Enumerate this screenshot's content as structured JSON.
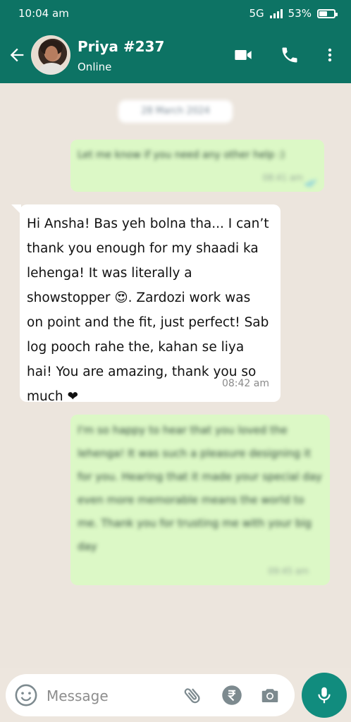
{
  "status_bar": {
    "time": "10:04 am",
    "network": "5G",
    "battery": "53%",
    "battery_level": 0.53
  },
  "header": {
    "name": "Priya #237",
    "status": "Online",
    "icons": [
      "back-arrow-icon",
      "video-call-icon",
      "voice-call-icon",
      "more-options-icon"
    ]
  },
  "chat": {
    "date_label": "28 March 2024",
    "messages": [
      {
        "direction": "outgoing",
        "text": "Let me know if you need any other help :)",
        "time": "08:41 am",
        "blurred": true
      },
      {
        "direction": "incoming",
        "text": "Hi Ansha! Bas yeh bolna tha... I can’t thank you enough for my shaadi ka lehenga! It was literally a showstopper 😍. Zardozi work was on point and the fit, just perfect! Sab log pooch rahe the, kahan se liya hai! You are amazing, thank you so much ❤",
        "time": "08:42 am"
      },
      {
        "direction": "outgoing",
        "text": "I'm so happy to hear that you loved the lehenga! It was such a pleasure designing it for you. Hearing that it made your special day even more memorable means the world to me. Thank you for trusting me with your big day",
        "time": "09:45 am",
        "blurred": true
      }
    ]
  },
  "composer": {
    "placeholder": "Message",
    "icons": [
      "emoji-icon",
      "attach-icon",
      "rupee-payment-icon",
      "camera-icon",
      "mic-icon"
    ]
  },
  "colors": {
    "header": "#0d7364",
    "outgoing_bubble": "#dcf8c6",
    "incoming_bubble": "#ffffff",
    "mic_button": "#118c7e"
  }
}
